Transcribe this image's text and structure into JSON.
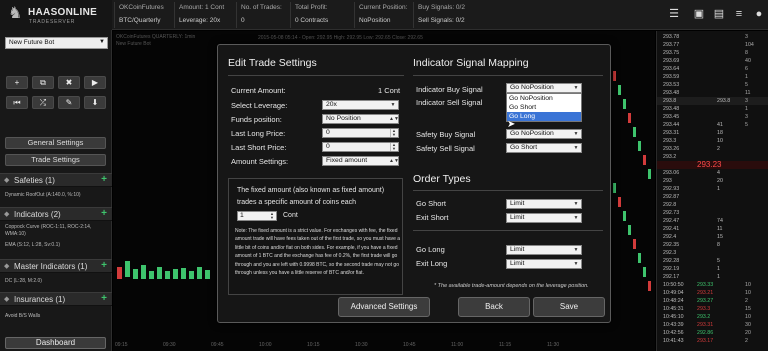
{
  "brand": {
    "name": "HAASONLINE",
    "sub": "TRADESERVER"
  },
  "topbar": {
    "stats": [
      {
        "key": "OKCoinFutures",
        "value": "BTC/Quarterly"
      },
      {
        "key": "Amount: 1 Cont",
        "value": "Leverage: 20x"
      },
      {
        "key": "No. of Trades:",
        "value": "0"
      },
      {
        "key": "Total Profit:",
        "value": "0 Contracts"
      },
      {
        "key": "Current Position:",
        "value": "NoPosition"
      },
      {
        "key": "Buy Signals: 0/2",
        "value": "Sell Signals: 0/2"
      }
    ],
    "icons": [
      "menu-icon",
      "wallet-icon",
      "cash-icon",
      "list-icon",
      "user-icon"
    ]
  },
  "sidebar": {
    "bot_select": "New Future Bot",
    "tools": [
      "+",
      "⧉",
      "🗑",
      "▶",
      "⏮",
      "⤮",
      "⌁",
      "⬇"
    ],
    "general_settings": "General Settings",
    "trade_settings": "Trade Settings",
    "sections": {
      "safeties": "Safeties (1)",
      "indicators": "Indicators (2)",
      "master": "Master Indicators (1)",
      "insurances": "Insurances (1)"
    },
    "safety_items": [
      "Dynamic RoofOut (A:140.0, %:10)"
    ],
    "indicator_items": [
      "Coppock Curve (ROC-1:11, ROC-2:14, WMA:10)",
      "EMA (S:12, L:28, Sv:0.1)"
    ],
    "master_items": [
      "DC (L:28, M:2.0)"
    ],
    "insurance_items": [
      "Avoid B/S Walls"
    ],
    "dashboard": "Dashboard"
  },
  "chart": {
    "title_line1": "OKCoinFutures QUARTERLY: 1min",
    "title_line2": "New Future Bot",
    "ohlc": "2015-05-08 05:14 - Open: 292.95 High: 292.95 Low: 292.65 Close: 292.65",
    "times": [
      "09:15",
      "09:30",
      "09:45",
      "10:00",
      "10:15",
      "10:30",
      "10:45",
      "11:00",
      "11:15",
      "11:30"
    ]
  },
  "ladder": {
    "rows": [
      {
        "price": "293.78",
        "col2": "",
        "col3": "3"
      },
      {
        "price": "293.77",
        "col2": "",
        "col3": "104"
      },
      {
        "price": "293.75",
        "col2": "",
        "col3": "8"
      },
      {
        "price": "293.69",
        "col2": "",
        "col3": "40"
      },
      {
        "price": "293.64",
        "col2": "",
        "col3": "6"
      },
      {
        "price": "293.59",
        "col2": "",
        "col3": "1"
      },
      {
        "price": "293.53",
        "col2": "",
        "col3": "5"
      },
      {
        "price": "293.48",
        "col2": "",
        "col3": "11"
      },
      {
        "price": "293.8",
        "col2": "293.8",
        "col3": "3"
      },
      {
        "price": "293.48",
        "col2": "",
        "col3": "1"
      },
      {
        "price": "293.45",
        "col2": "",
        "col3": "3"
      },
      {
        "price": "293.44",
        "col2": "41",
        "col3": "5"
      },
      {
        "price": "293.31",
        "col2": "18",
        "col3": ""
      },
      {
        "price": "293.3",
        "col2": "10",
        "col3": ""
      },
      {
        "price": "293.26",
        "col2": "2",
        "col3": ""
      },
      {
        "price": "293.2",
        "col2": "",
        "col3": ""
      },
      {
        "price": "",
        "col2": "293.23",
        "col3": ""
      },
      {
        "price": "293.06",
        "col2": "4",
        "col3": ""
      },
      {
        "price": "293",
        "col2": "20",
        "col3": ""
      },
      {
        "price": "292.93",
        "col2": "1",
        "col3": ""
      },
      {
        "price": "292.87",
        "col2": "",
        "col3": ""
      },
      {
        "price": "292.8",
        "col2": "",
        "col3": ""
      },
      {
        "price": "292.73",
        "col2": "",
        "col3": ""
      },
      {
        "price": "292.47",
        "col2": "74",
        "col3": ""
      },
      {
        "price": "292.41",
        "col2": "11",
        "col3": ""
      },
      {
        "price": "292.4",
        "col2": "15",
        "col3": ""
      },
      {
        "price": "292.35",
        "col2": "8",
        "col3": ""
      },
      {
        "price": "292.3",
        "col2": "",
        "col3": ""
      },
      {
        "price": "292.28",
        "col2": "5",
        "col3": ""
      },
      {
        "price": "292.19",
        "col2": "1",
        "col3": ""
      },
      {
        "price": "292.17",
        "col2": "1",
        "col3": ""
      },
      {
        "price": "10:50:50",
        "col2": "293.33",
        "col3": "10"
      },
      {
        "price": "10:49:04",
        "col2": "293.21",
        "col3": "10"
      },
      {
        "price": "10:48:24",
        "col2": "293.27",
        "col3": "2"
      },
      {
        "price": "10:45:31",
        "col2": "293.3",
        "col3": "15"
      },
      {
        "price": "10:45:10",
        "col2": "293.2",
        "col3": "10"
      },
      {
        "price": "10:43:39",
        "col2": "293.31",
        "col3": "30"
      },
      {
        "price": "10:42:56",
        "col2": "292.86",
        "col3": "20"
      },
      {
        "price": "10:41:43",
        "col2": "293.17",
        "col3": "2"
      }
    ]
  },
  "modal": {
    "left_title": "Edit Trade Settings",
    "right_title": "Indicator Signal Mapping",
    "order_title": "Order Types",
    "current_amount_label": "Current Amount:",
    "current_amount_value": "1 Cont",
    "leverage_label": "Select Leverage:",
    "leverage_value": "20x",
    "funds_label": "Funds position:",
    "funds_value": "No Position",
    "last_long_label": "Last Long Price:",
    "last_long_value": "0",
    "last_short_label": "Last Short Price:",
    "last_short_value": "0",
    "amount_settings_label": "Amount Settings:",
    "amount_settings_value": "Fixed amount",
    "fixed_info": "The fixed amount (also known as fixed amount) trades a specific amount of coins each",
    "fixed_value": "1",
    "fixed_unit": "Cont",
    "note": "Note: The fixed amount is a strict value. For exchanges with fee, the fixed amount trade will have fees taken out of the first trade, so you must have a little bit of coins and/or fiat on both sides. For example, if you have a fixed amount of 1 BTC and the exchange has fee of 0.2%, the first trade will go through and you are left with 0.9998 BTC, so the second trade may not go through unless you have a little reserve of BTC and/or fiat.",
    "ind_buy_label": "Indicator Buy Signal",
    "ind_buy_value": "Go NoPosition",
    "ind_sell_label": "Indicator Sell Signal",
    "dropdown_options": [
      "Go NoPosition",
      "Go Short",
      "Go Long"
    ],
    "dropdown_selected_index": 2,
    "safety_buy_label": "Safety Buy Signal",
    "safety_buy_value": "Go NoPosition",
    "safety_sell_label": "Safety Sell Signal",
    "safety_sell_value": "Go Short",
    "go_short_label": "Go Short",
    "go_short_value": "Limit",
    "exit_short_label": "Exit Short",
    "exit_short_value": "Limit",
    "go_long_label": "Go Long",
    "go_long_value": "Limit",
    "exit_long_label": "Exit Long",
    "exit_long_value": "Limit",
    "footnote": "* The available trade-amount depends on the leverage position.",
    "advanced_btn": "Advanced Settings",
    "back_btn": "Back",
    "save_btn": "Save"
  },
  "colors": {
    "green": "#3ec46d",
    "red": "#d23b3b",
    "highlight": "#3a74d6"
  }
}
